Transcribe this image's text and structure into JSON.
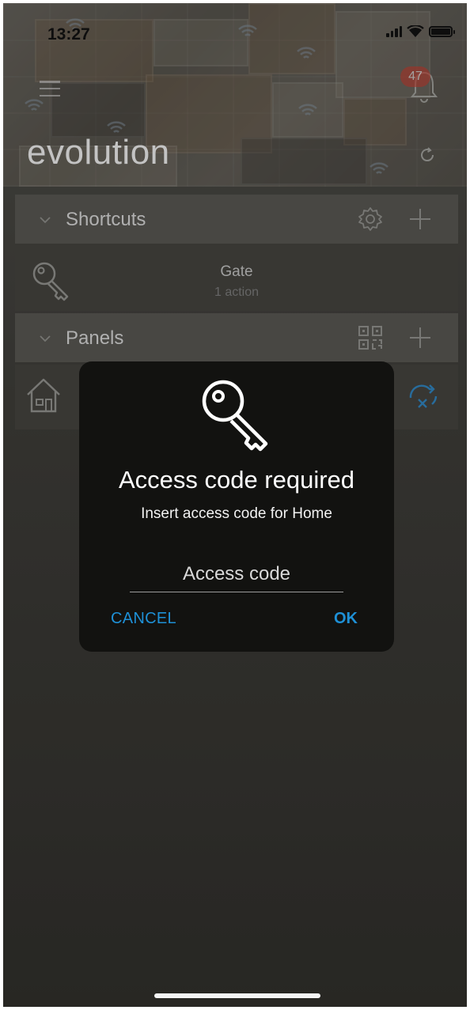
{
  "status_bar": {
    "time": "13:27"
  },
  "header": {
    "title": "evolution",
    "notification_count": "47",
    "icons": [
      "menu-icon",
      "bell-icon",
      "refresh-icon"
    ]
  },
  "sections": {
    "shortcuts": {
      "title": "Shortcuts",
      "items": [
        {
          "title": "Gate",
          "subtitle": "1 action",
          "icon": "key-icon"
        }
      ]
    },
    "panels": {
      "title": "Panels",
      "items": [
        {
          "icon": "house-icon",
          "status_icon": "sync-off-icon"
        }
      ]
    }
  },
  "dialog": {
    "title": "Access code required",
    "message": "Insert access code for Home",
    "input": {
      "placeholder": "Access code",
      "value": ""
    },
    "cancel_label": "CANCEL",
    "ok_label": "OK",
    "accent_color": "#1e90d6"
  }
}
